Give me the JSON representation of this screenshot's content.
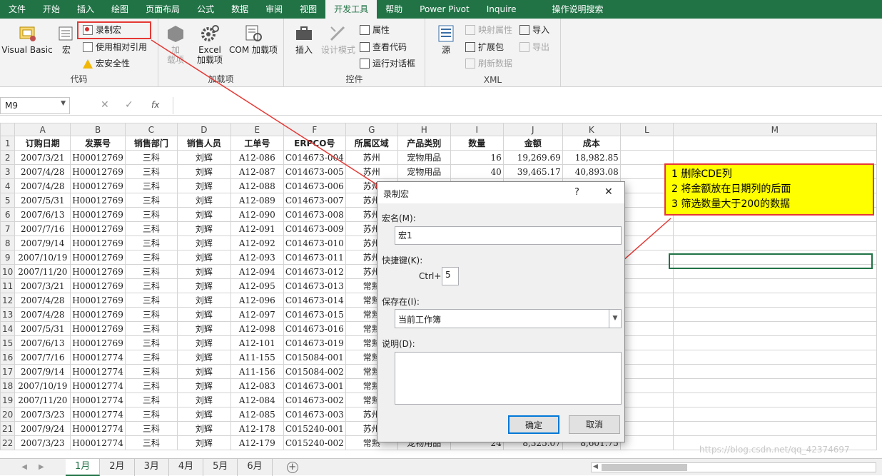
{
  "tabs": [
    "文件",
    "开始",
    "插入",
    "绘图",
    "页面布局",
    "公式",
    "数据",
    "审阅",
    "视图",
    "开发工具",
    "帮助",
    "Power Pivot",
    "Inquire",
    "操作说明搜索"
  ],
  "ribbon": {
    "code": {
      "visual_basic": "Visual Basic",
      "macro": "宏",
      "record_macro": "录制宏",
      "relative_ref": "使用相对引用",
      "macro_security": "宏安全性",
      "label": "代码"
    },
    "addins": {
      "addins": "加\n载项",
      "excel_addins": "Excel\n加载项",
      "com_addins": "COM 加载项",
      "label": "加载项"
    },
    "controls": {
      "insert": "插入",
      "design_mode": "设计模式",
      "properties": "属性",
      "view_code": "查看代码",
      "run_dialog": "运行对话框",
      "label": "控件"
    },
    "xml": {
      "source": "源",
      "map_props": "映射属性",
      "expansion": "扩展包",
      "refresh": "刷新数据",
      "import": "导入",
      "export": "导出",
      "label": "XML"
    }
  },
  "formula_bar": {
    "name_box": "M9",
    "fx": "fx",
    "value": ""
  },
  "columns": [
    "A",
    "B",
    "C",
    "D",
    "E",
    "F",
    "G",
    "H",
    "I",
    "J",
    "K",
    "L",
    "M"
  ],
  "headers": [
    "订购日期",
    "发票号",
    "销售部门",
    "销售人员",
    "工单号",
    "ERPCO号",
    "所属区域",
    "产品类别",
    "数量",
    "金额",
    "成本"
  ],
  "rows": [
    [
      "2007/3/21",
      "H00012769",
      "三科",
      "刘辉",
      "A12-086",
      "C014673-004",
      "苏州",
      "宠物用品",
      "16",
      "19,269.69",
      "18,982.85"
    ],
    [
      "2007/4/28",
      "H00012769",
      "三科",
      "刘辉",
      "A12-087",
      "C014673-005",
      "苏州",
      "宠物用品",
      "40",
      "39,465.17",
      "40,893.08"
    ],
    [
      "2007/4/28",
      "H00012769",
      "三科",
      "刘辉",
      "A12-088",
      "C014673-006",
      "苏州",
      "",
      "",
      "",
      ""
    ],
    [
      "2007/5/31",
      "H00012769",
      "三科",
      "刘辉",
      "A12-089",
      "C014673-007",
      "苏州",
      "",
      "",
      "",
      ""
    ],
    [
      "2007/6/13",
      "H00012769",
      "三科",
      "刘辉",
      "A12-090",
      "C014673-008",
      "苏州",
      "",
      "",
      "",
      ""
    ],
    [
      "2007/7/16",
      "H00012769",
      "三科",
      "刘辉",
      "A12-091",
      "C014673-009",
      "苏州",
      "",
      "",
      "",
      ""
    ],
    [
      "2007/9/14",
      "H00012769",
      "三科",
      "刘辉",
      "A12-092",
      "C014673-010",
      "苏州",
      "",
      "",
      "",
      ""
    ],
    [
      "2007/10/19",
      "H00012769",
      "三科",
      "刘辉",
      "A12-093",
      "C014673-011",
      "苏州",
      "",
      "",
      "",
      ""
    ],
    [
      "2007/11/20",
      "H00012769",
      "三科",
      "刘辉",
      "A12-094",
      "C014673-012",
      "苏州",
      "",
      "",
      "",
      ""
    ],
    [
      "2007/3/21",
      "H00012769",
      "三科",
      "刘辉",
      "A12-095",
      "C014673-013",
      "常熟",
      "",
      "",
      "",
      ""
    ],
    [
      "2007/4/28",
      "H00012769",
      "三科",
      "刘辉",
      "A12-096",
      "C014673-014",
      "常熟",
      "",
      "",
      "",
      ""
    ],
    [
      "2007/4/28",
      "H00012769",
      "三科",
      "刘辉",
      "A12-097",
      "C014673-015",
      "常熟",
      "",
      "",
      "",
      ""
    ],
    [
      "2007/5/31",
      "H00012769",
      "三科",
      "刘辉",
      "A12-098",
      "C014673-016",
      "常熟",
      "",
      "",
      "",
      ""
    ],
    [
      "2007/6/13",
      "H00012769",
      "三科",
      "刘辉",
      "A12-101",
      "C014673-019",
      "常熟",
      "",
      "",
      "",
      ""
    ],
    [
      "2007/7/16",
      "H00012774",
      "三科",
      "刘辉",
      "A11-155",
      "C015084-001",
      "常熟",
      "",
      "",
      "",
      ""
    ],
    [
      "2007/9/14",
      "H00012774",
      "三科",
      "刘辉",
      "A11-156",
      "C015084-002",
      "常熟",
      "",
      "",
      "",
      ""
    ],
    [
      "2007/10/19",
      "H00012774",
      "三科",
      "刘辉",
      "A12-083",
      "C014673-001",
      "常熟",
      "",
      "",
      "",
      ""
    ],
    [
      "2007/11/20",
      "H00012774",
      "三科",
      "刘辉",
      "A12-084",
      "C014673-002",
      "常熟",
      "",
      "",
      "",
      ""
    ],
    [
      "2007/3/23",
      "H00012774",
      "三科",
      "刘辉",
      "A12-085",
      "C014673-003",
      "苏州",
      "",
      "",
      "",
      ""
    ],
    [
      "2007/9/24",
      "H00012774",
      "三科",
      "刘辉",
      "A12-178",
      "C015240-001",
      "苏州",
      "",
      "",
      "",
      ""
    ],
    [
      "2007/3/23",
      "H00012774",
      "三科",
      "刘辉",
      "A12-179",
      "C015240-002",
      "常熟",
      "宠物用品",
      "24",
      "8,325.07",
      "8,601.75"
    ]
  ],
  "note": [
    "1 删除CDE列",
    "2 将金额放在日期列的后面",
    "3 筛选数量大于200的数据"
  ],
  "dialog": {
    "title": "录制宏",
    "help": "?",
    "close": "✕",
    "name_label": "宏名(M):",
    "name_value": "宏1",
    "shortcut_label": "快捷键(K):",
    "ctrl": "Ctrl+",
    "shortcut_value": "5",
    "store_label": "保存在(I):",
    "store_value": "当前工作簿",
    "desc_label": "说明(D):",
    "desc_value": "",
    "ok": "确定",
    "cancel": "取消"
  },
  "sheets": [
    "1月",
    "2月",
    "3月",
    "4月",
    "5月",
    "6月"
  ],
  "watermark": "https://blog.csdn.net/qq_42374697",
  "colors": {
    "accent": "#217346",
    "note_bg": "#ffff00",
    "arrow": "#e53935"
  }
}
